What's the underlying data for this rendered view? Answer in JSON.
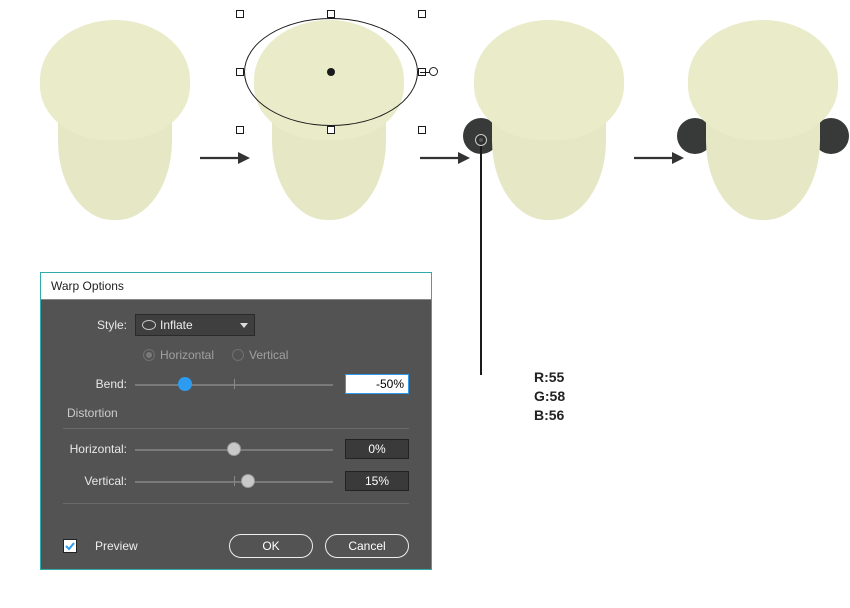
{
  "shapes": {
    "fill_light": "#e9ebc9",
    "ear_fill": "#373a38"
  },
  "rgb_label": {
    "r": "R:55",
    "g": "G:58",
    "b": "B:56"
  },
  "dialog": {
    "title": "Warp Options",
    "style_label": "Style:",
    "style_value": "Inflate",
    "orient_h": "Horizontal",
    "orient_v": "Vertical",
    "bend_label": "Bend:",
    "bend_value": "-50%",
    "distortion_label": "Distortion",
    "dist_h_label": "Horizontal:",
    "dist_h_value": "0%",
    "dist_v_label": "Vertical:",
    "dist_v_value": "15%",
    "preview_label": "Preview",
    "ok": "OK",
    "cancel": "Cancel"
  }
}
